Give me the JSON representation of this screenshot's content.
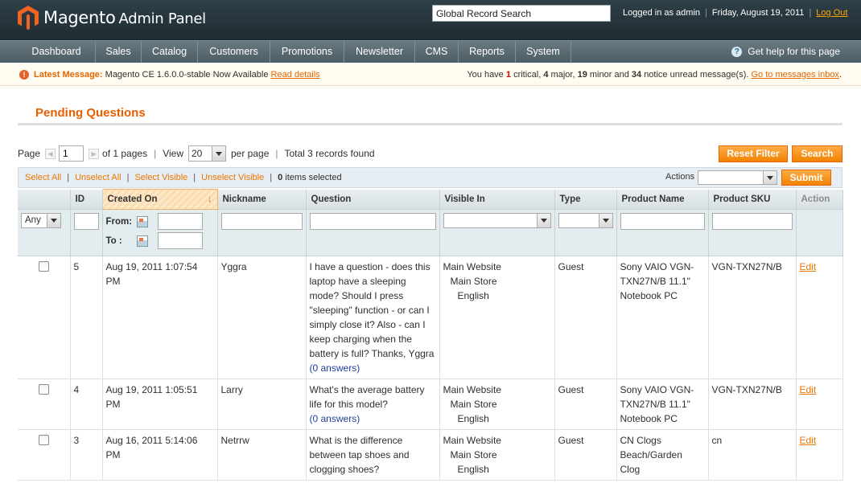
{
  "header": {
    "logo_brand": "Magento",
    "logo_suffix": "Admin Panel",
    "global_search_value": "Global Record Search",
    "logged_in": "Logged in as admin",
    "date": "Friday, August 19, 2011",
    "logout": "Log Out"
  },
  "nav": {
    "items": [
      "Dashboard",
      "Sales",
      "Catalog",
      "Customers",
      "Promotions",
      "Newsletter",
      "CMS",
      "Reports",
      "System"
    ],
    "help": "Get help for this page"
  },
  "notice": {
    "label": "Latest Message:",
    "text": "Magento CE 1.6.0.0-stable Now Available",
    "read_details": "Read details",
    "you_have": "You have",
    "critical_count": "1",
    "critical": "critical,",
    "major_count": "4",
    "major": "major,",
    "minor_count": "19",
    "minor": "minor and",
    "notice_count": "34",
    "notice_tail": "notice unread message(s).",
    "inbox_link": "Go to messages inbox",
    "inbox_tail": "."
  },
  "page": {
    "title": "Pending Questions"
  },
  "pager": {
    "page_label": "Page",
    "page_value": "1",
    "of_pages": "of 1 pages",
    "sep": "|",
    "view_label": "View",
    "view_value": "20",
    "per_page": "per page",
    "total": "Total 3 records found",
    "reset_filter": "Reset Filter",
    "search": "Search"
  },
  "massaction": {
    "select_all": "Select All",
    "unselect_all": "Unselect All",
    "select_visible": "Select Visible",
    "unselect_visible": "Unselect Visible",
    "sep": "|",
    "selected_count": "0",
    "selected_label": "items selected",
    "actions_label": "Actions",
    "submit": "Submit"
  },
  "grid": {
    "columns": {
      "id": "ID",
      "created_on": "Created On",
      "nickname": "Nickname",
      "question": "Question",
      "visible_in": "Visible In",
      "type": "Type",
      "product_name": "Product Name",
      "product_sku": "Product SKU",
      "action": "Action"
    },
    "filters": {
      "any": "Any",
      "from": "From:",
      "to": "To :"
    },
    "rows": [
      {
        "id": "5",
        "created": "Aug 19, 2011 1:07:54 PM",
        "nickname": "Yggra",
        "question": "I have a question - does this laptop have a sleeping mode? Should I press \"sleeping\" function - or can I simply close it? Also - can I keep charging when the battery is full? Thanks, Yggra",
        "answers": "(0 answers)",
        "website": "Main Website",
        "store": "Main Store",
        "view": "English",
        "type": "Guest",
        "product_name": "Sony VAIO VGN-TXN27N/B 11.1\" Notebook PC",
        "sku": "VGN-TXN27N/B",
        "action": "Edit"
      },
      {
        "id": "4",
        "created": "Aug 19, 2011 1:05:51 PM",
        "nickname": "Larry",
        "question": "What's the average battery life for this model?",
        "answers": "(0 answers)",
        "website": "Main Website",
        "store": "Main Store",
        "view": "English",
        "type": "Guest",
        "product_name": "Sony VAIO VGN-TXN27N/B 11.1\" Notebook PC",
        "sku": "VGN-TXN27N/B",
        "action": "Edit"
      },
      {
        "id": "3",
        "created": "Aug 16, 2011 5:14:06 PM",
        "nickname": "Netrrw",
        "question": "What is the difference between tap shoes and clogging shoes?",
        "answers": "",
        "website": "Main Website",
        "store": "Main Store",
        "view": "English",
        "type": "Guest",
        "product_name": "CN Clogs Beach/Garden Clog",
        "sku": "cn",
        "action": "Edit"
      }
    ]
  },
  "colors": {
    "brand_orange": "#eb5e00",
    "header_dark": "#2f4048",
    "nav_gray": "#5c6c73",
    "critical_red": "#d40707",
    "link_orange": "#ea7601"
  }
}
